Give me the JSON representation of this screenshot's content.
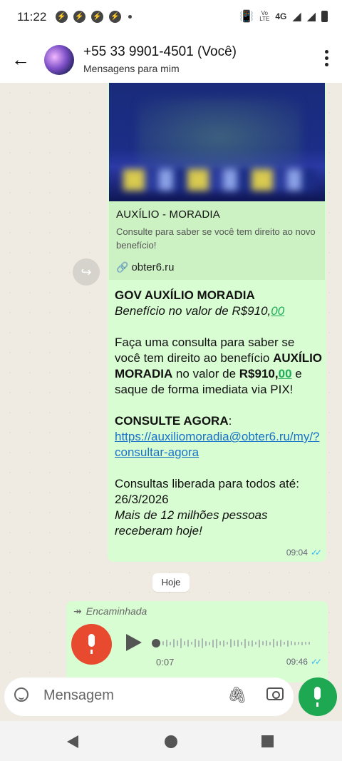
{
  "status_bar": {
    "time": "11:22",
    "network": "4G",
    "volte": "Vo\nLTE"
  },
  "header": {
    "title": "+55 33 9901-4501 (Você)",
    "subtitle": "Mensagens para mim"
  },
  "message1": {
    "link_preview": {
      "title": "AUXÍLIO - MORADIA",
      "description": "Consulte para saber se você tem direito ao novo benefício!",
      "url": "obter6.ru"
    },
    "line1": "GOV AUXÍLIO MORADIA",
    "line2_a": "Benefício no valor de R$910,",
    "line2_b": "00",
    "p2_a": " Faça uma consulta para saber se você tem direito ao benefício ",
    "p2_b": "AUXÍLIO MORADIA",
    "p2_c": " no valor de ",
    "p2_d": "R$910,",
    "p2_e": "00",
    "p2_f": " e saque de forma imediata via PIX!",
    "p3_a": " CONSULTE AGORA",
    "p3_b": ":",
    "p3_link": "https://auxiliomoradia@obter6.ru/my/?consultar-agora",
    "p4_a": " Consultas liberada para todos até: 26/3/2026",
    "p4_b": "Mais de 12 milhões pessoas receberam hoje!",
    "time": "09:04"
  },
  "date_chip": "Hoje",
  "message2": {
    "forwarded_label": "Encaminhada",
    "duration": "0:07",
    "time": "09:46"
  },
  "input": {
    "placeholder": "Mensagem"
  },
  "colors": {
    "bubble": "#d9fdd3",
    "link": "#1871c9",
    "accent": "#1da851",
    "record": "#e84a2f"
  }
}
